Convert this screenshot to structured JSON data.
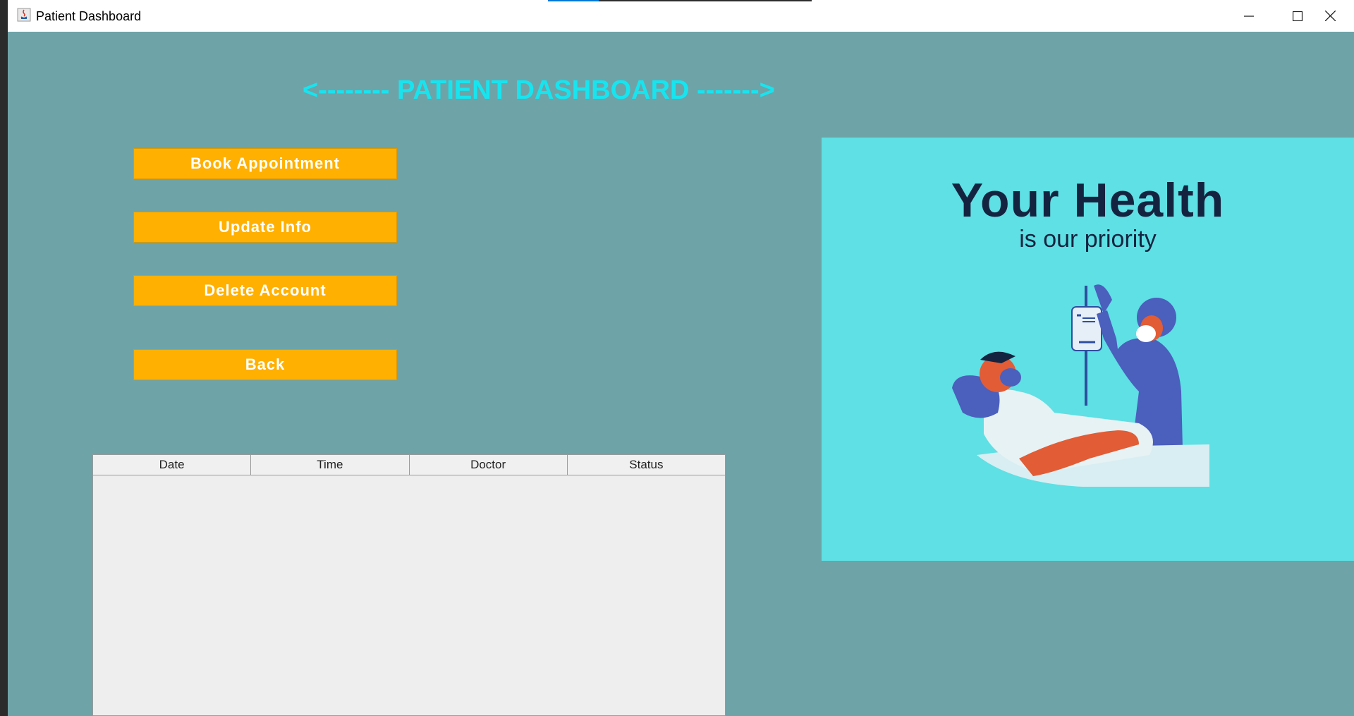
{
  "window": {
    "title": "Patient Dashboard"
  },
  "heading": "<-------- PATIENT DASHBOARD ------->",
  "buttons": {
    "book": "Book Appointment",
    "update": "Update Info",
    "delete": "Delete Account",
    "back": "Back"
  },
  "table": {
    "columns": [
      "Date",
      "Time",
      "Doctor",
      "Status"
    ],
    "rows": []
  },
  "poster": {
    "title": "Your Health",
    "subtitle": "is our priority"
  },
  "colors": {
    "background": "#6ea3a8",
    "heading": "#16e5f0",
    "button": "#ffb000",
    "poster_bg": "#5ee0e4"
  },
  "icons": [
    "java-app-icon",
    "minimize-icon",
    "maximize-icon",
    "close-icon"
  ]
}
